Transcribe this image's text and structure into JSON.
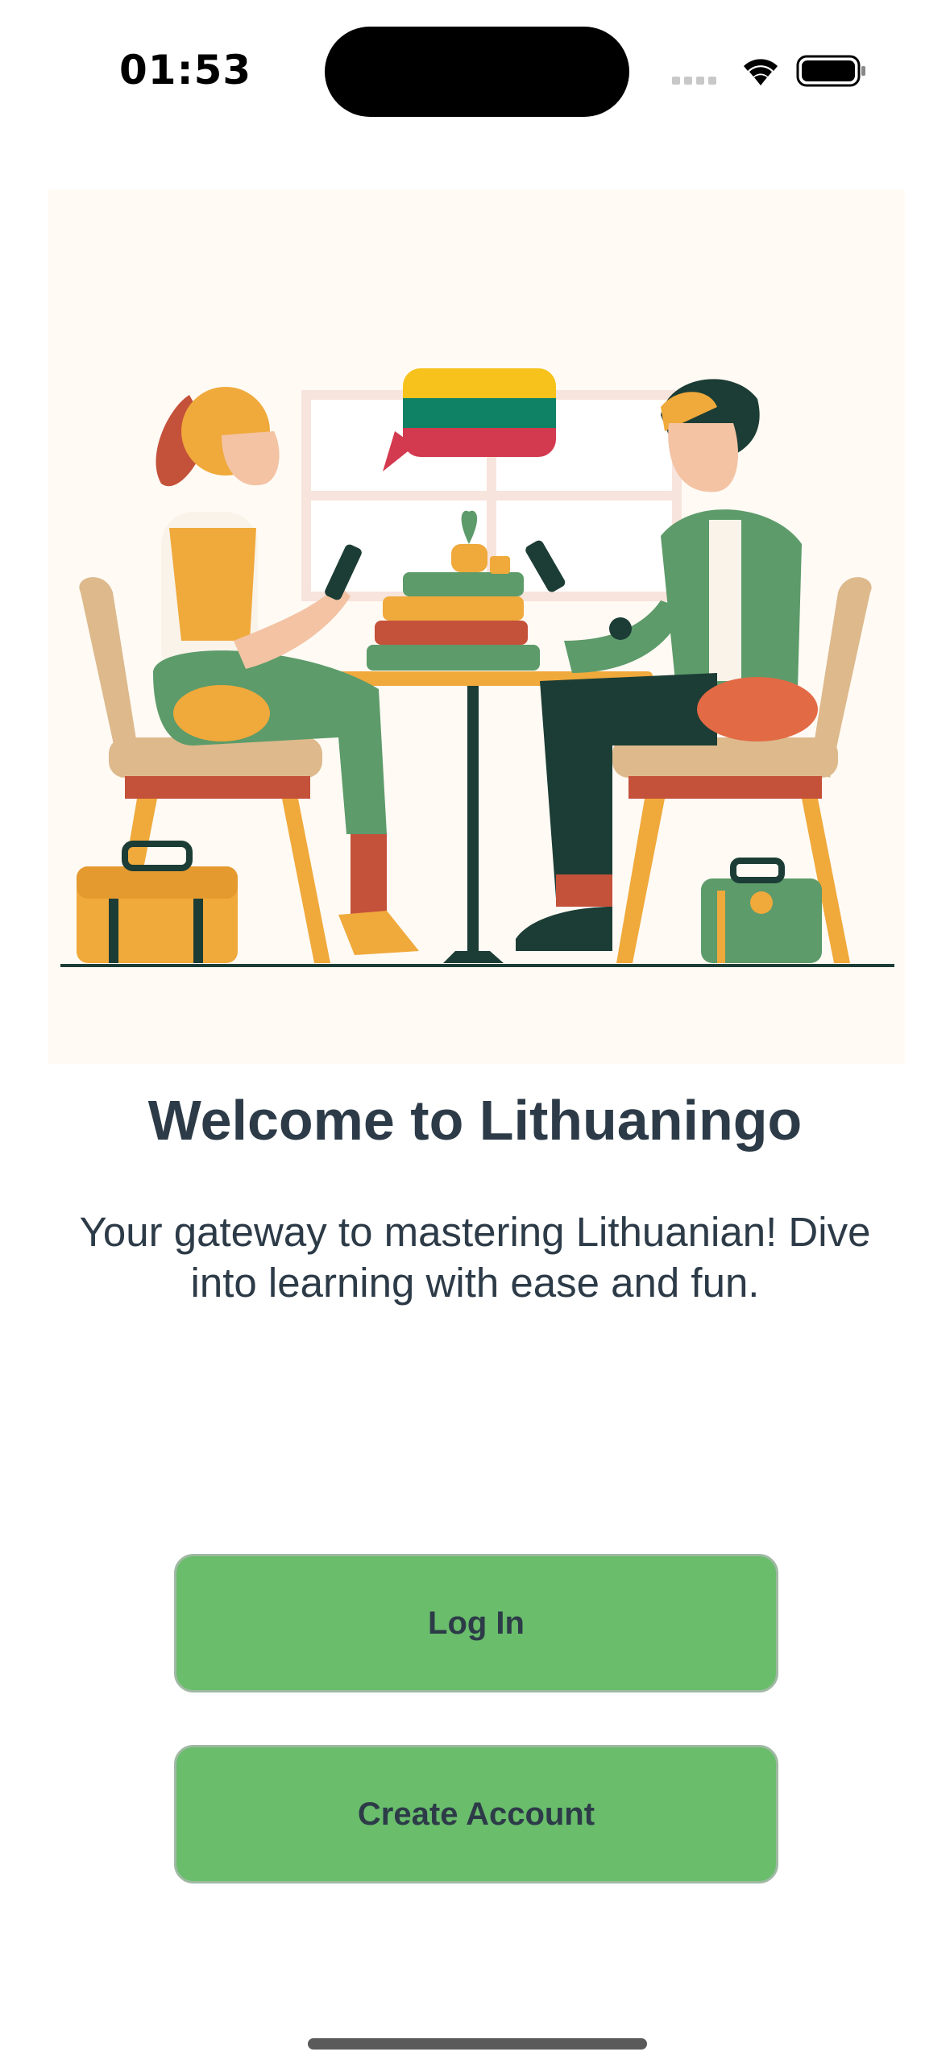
{
  "status_bar": {
    "time": "01:53",
    "icons": [
      "signal-icon",
      "wifi-icon",
      "battery-icon"
    ]
  },
  "hero": {
    "illustration": "two-people-learning-on-phones-illustration",
    "flag_colors": [
      "#fdb913",
      "#006a44",
      "#c1272d"
    ]
  },
  "welcome": {
    "title": "Welcome to Lithuaningo",
    "subtitle": "Your gateway to mastering Lithuanian! Dive into learning with ease and fun."
  },
  "actions": {
    "login_label": "Log In",
    "create_account_label": "Create Account"
  },
  "colors": {
    "button_green": "#69bd6b",
    "text_dark": "#2d3b48"
  }
}
